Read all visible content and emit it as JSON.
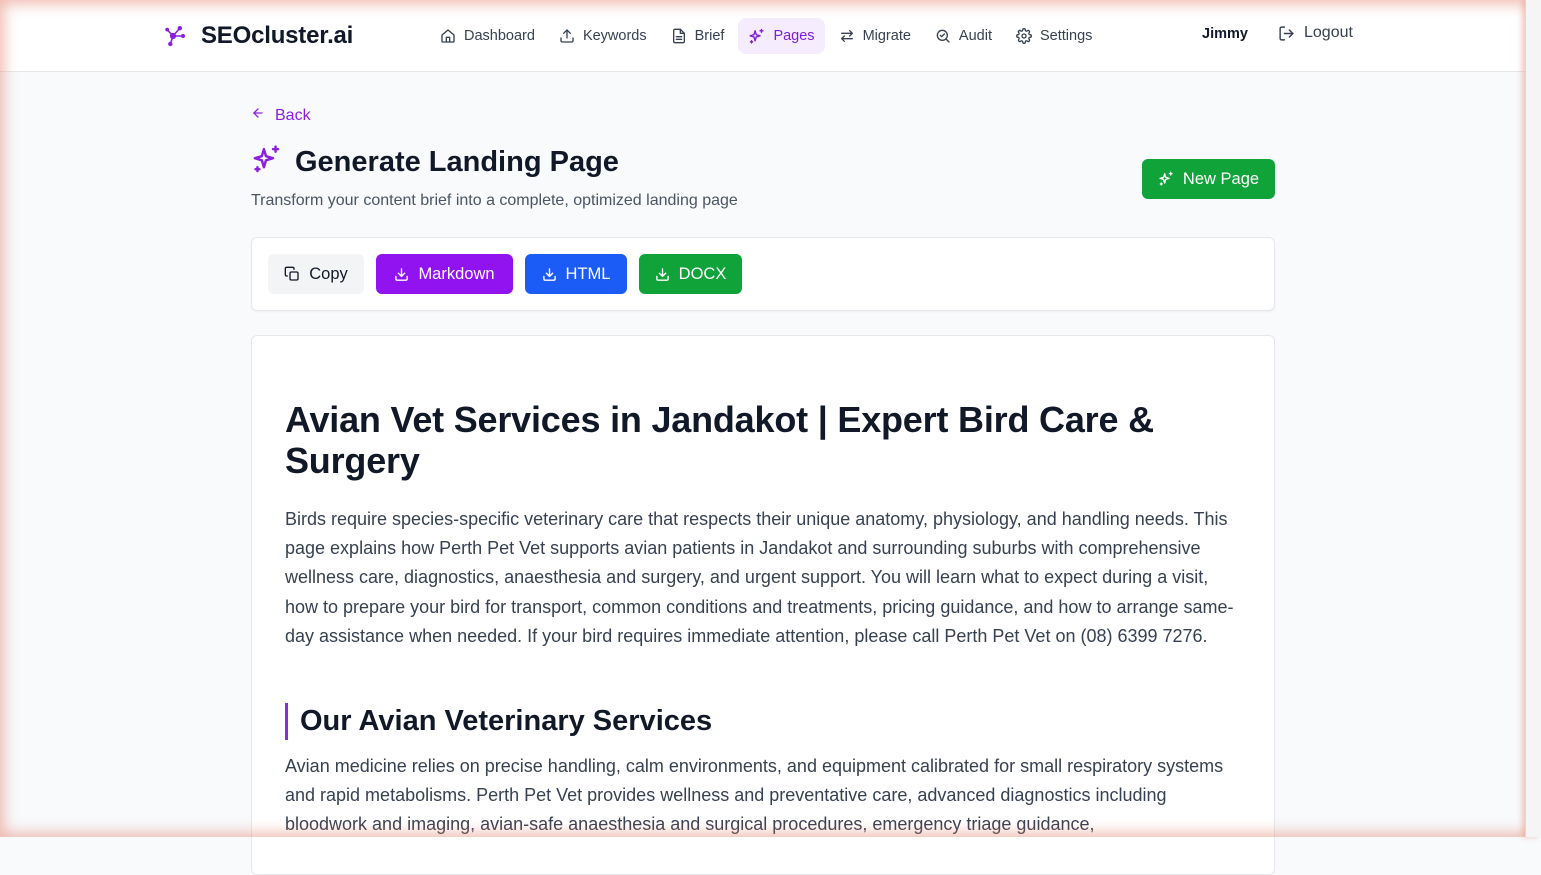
{
  "app": {
    "brand_name": "SEOcluster.ai"
  },
  "nav": {
    "items": [
      {
        "label": "Dashboard",
        "icon": "home-icon"
      },
      {
        "label": "Keywords",
        "icon": "upload-icon"
      },
      {
        "label": "Brief",
        "icon": "file-text-icon"
      },
      {
        "label": "Pages",
        "icon": "sparkles-icon",
        "active": true
      },
      {
        "label": "Migrate",
        "icon": "arrows-left-right-icon"
      },
      {
        "label": "Audit",
        "icon": "search-audit-icon"
      },
      {
        "label": "Settings",
        "icon": "gear-icon"
      }
    ],
    "user_name": "Jimmy",
    "logout_label": "Logout"
  },
  "page": {
    "back_label": "Back",
    "title": "Generate Landing Page",
    "subtitle": "Transform your content brief into a complete, optimized landing page",
    "new_page_label": "New Page"
  },
  "toolbar": {
    "copy_label": "Copy",
    "markdown_label": "Markdown",
    "html_label": "HTML",
    "docx_label": "DOCX"
  },
  "content": {
    "h1": "Avian Vet Services in Jandakot | Expert Bird Care & Surgery",
    "intro": "Birds require species-specific veterinary care that respects their unique anatomy, physiology, and handling needs. This page explains how Perth Pet Vet supports avian patients in Jandakot and surrounding suburbs with comprehensive wellness care, diagnostics, anaesthesia and surgery, and urgent support. You will learn what to expect during a visit, how to prepare your bird for transport, common conditions and treatments, pricing guidance, and how to arrange same-day assistance when needed. If your bird requires immediate attention, please call Perth Pet Vet on (08) 6399 7276.",
    "h2": "Our Avian Veterinary Services",
    "services_text": "Avian medicine relies on precise handling, calm environments, and equipment calibrated for small respiratory systems and rapid metabolisms. Perth Pet Vet provides wellness and preventative care, advanced diagnostics including bloodwork and imaging, avian-safe anaesthesia and surgical procedures, emergency triage guidance,"
  },
  "colors": {
    "accent_purple": "#9013f0",
    "nav_active_bg": "#f5ecfe",
    "green": "#10a33a",
    "blue": "#1a5cf5"
  }
}
